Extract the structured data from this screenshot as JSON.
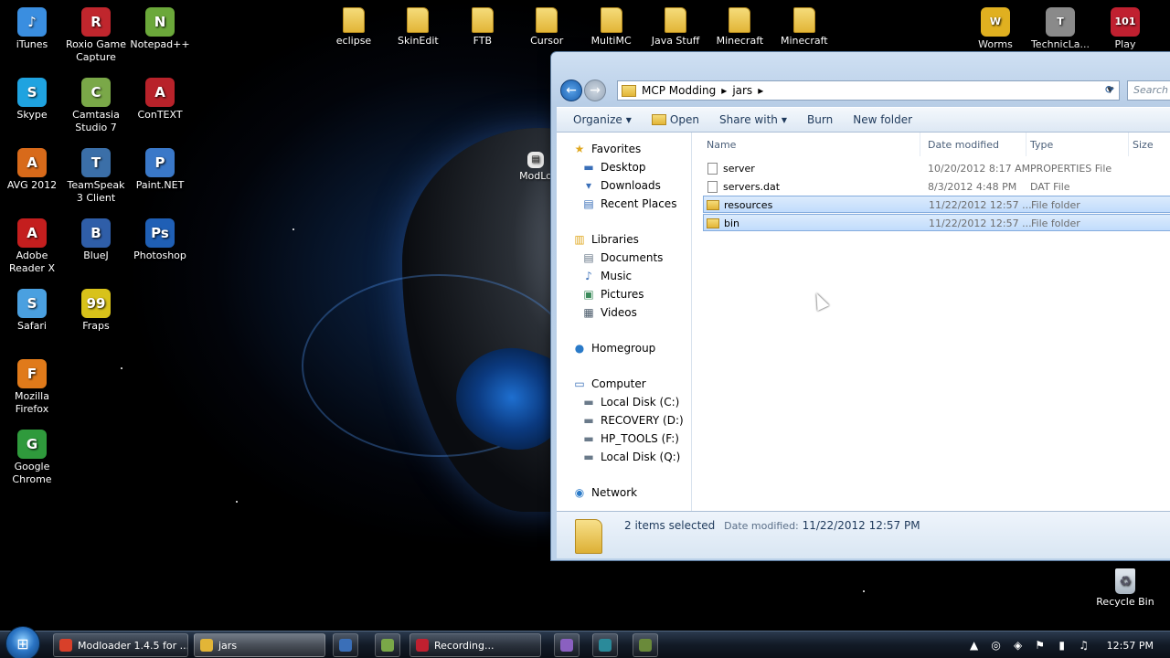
{
  "desktop": {
    "icons": [
      {
        "label": "iTunes",
        "color": "#3a8ee0",
        "glyph": "♪"
      },
      {
        "label": "Roxio Game Capture",
        "color": "#c0262d",
        "glyph": "R"
      },
      {
        "label": "Notepad++",
        "color": "#6ba83a",
        "glyph": "N"
      },
      {
        "label": "Skype",
        "color": "#1fa3e0",
        "glyph": "S"
      },
      {
        "label": "Camtasia Studio 7",
        "color": "#7aa848",
        "glyph": "C"
      },
      {
        "label": "ConTEXT",
        "color": "#b8222a",
        "glyph": "A"
      },
      {
        "label": "AVG 2012",
        "color": "#d86a1a",
        "glyph": "A"
      },
      {
        "label": "TeamSpeak 3 Client",
        "color": "#3b6fa8",
        "glyph": "T"
      },
      {
        "label": "Paint.NET",
        "color": "#3a78c8",
        "glyph": "P"
      },
      {
        "label": "Adobe Reader X",
        "color": "#c41e1e",
        "glyph": "A"
      },
      {
        "label": "BlueJ",
        "color": "#2f5ea8",
        "glyph": "B"
      },
      {
        "label": "Photoshop",
        "color": "#1f5fb5",
        "glyph": "Ps"
      },
      {
        "label": "Safari",
        "color": "#4aa0e0",
        "glyph": "S"
      },
      {
        "label": "Fraps",
        "color": "#d8c21a",
        "glyph": "99"
      },
      {
        "label": "Mozilla Firefox",
        "color": "#e07a1a",
        "glyph": "F"
      },
      {
        "label": "Google Chrome",
        "color": "#2f9a3c",
        "glyph": "G"
      }
    ],
    "top_folders": [
      "eclipse",
      "SkinEdit",
      "FTB",
      "Cursor",
      "MultiMC",
      "Java Stuff",
      "Minecraft",
      "Minecraft"
    ],
    "right_icons": [
      {
        "label": "Worms",
        "color": "#e0b020",
        "glyph": "W"
      },
      {
        "label": "TechnicLa...",
        "color": "#8a8a8a",
        "glyph": "T"
      },
      {
        "label": "Play",
        "color": "#c02030",
        "glyph": "101"
      }
    ],
    "partial_icon_label": "ModLo",
    "recycle_bin": "Recycle Bin"
  },
  "explorer": {
    "breadcrumb": [
      "MCP Modding",
      "jars"
    ],
    "search_placeholder": "Search",
    "toolbar": {
      "organize": "Organize",
      "open": "Open",
      "share_with": "Share with",
      "burn": "Burn",
      "new_folder": "New folder"
    },
    "nav": {
      "favorites": "Favorites",
      "desktop": "Desktop",
      "downloads": "Downloads",
      "recent_places": "Recent Places",
      "libraries": "Libraries",
      "documents": "Documents",
      "music": "Music",
      "pictures": "Pictures",
      "videos": "Videos",
      "homegroup": "Homegroup",
      "computer": "Computer",
      "local_c": "Local Disk (C:)",
      "recovery_d": "RECOVERY (D:)",
      "hp_tools_f": "HP_TOOLS (F:)",
      "local_q": "Local Disk (Q:)",
      "network": "Network"
    },
    "columns": {
      "name": "Name",
      "date": "Date modified",
      "type": "Type",
      "size": "Size"
    },
    "files": [
      {
        "name": "server",
        "date": "10/20/2012 8:17 AM",
        "type": "PROPERTIES File",
        "kind": "file",
        "selected": false
      },
      {
        "name": "servers.dat",
        "date": "8/3/2012 4:48 PM",
        "type": "DAT File",
        "kind": "file",
        "selected": false
      },
      {
        "name": "resources",
        "date": "11/22/2012 12:57 ...",
        "type": "File folder",
        "kind": "folder",
        "selected": true
      },
      {
        "name": "bin",
        "date": "11/22/2012 12:57 ...",
        "type": "File folder",
        "kind": "folder",
        "selected": true
      }
    ],
    "details": {
      "count": "2 items selected",
      "date_label": "Date modified:",
      "date_value": "11/22/2012 12:57 PM"
    }
  },
  "taskbar": {
    "buttons": [
      {
        "label": "Modloader 1.4.5 for ...",
        "color": "#d8402a",
        "active": false
      },
      {
        "label": "jars",
        "color": "#e2b537",
        "active": true
      },
      {
        "label": "",
        "color": "#3a6fb8",
        "active": false
      },
      {
        "label": "",
        "color": "#7aa848",
        "active": false
      },
      {
        "label": "Recording...",
        "color": "#c02030",
        "active": false
      },
      {
        "label": "",
        "color": "#8a60c0",
        "active": false
      },
      {
        "label": "",
        "color": "#2a8a9a",
        "active": false
      },
      {
        "label": "",
        "color": "#6a8a3a",
        "active": false
      }
    ],
    "clock": "12:57 PM"
  }
}
